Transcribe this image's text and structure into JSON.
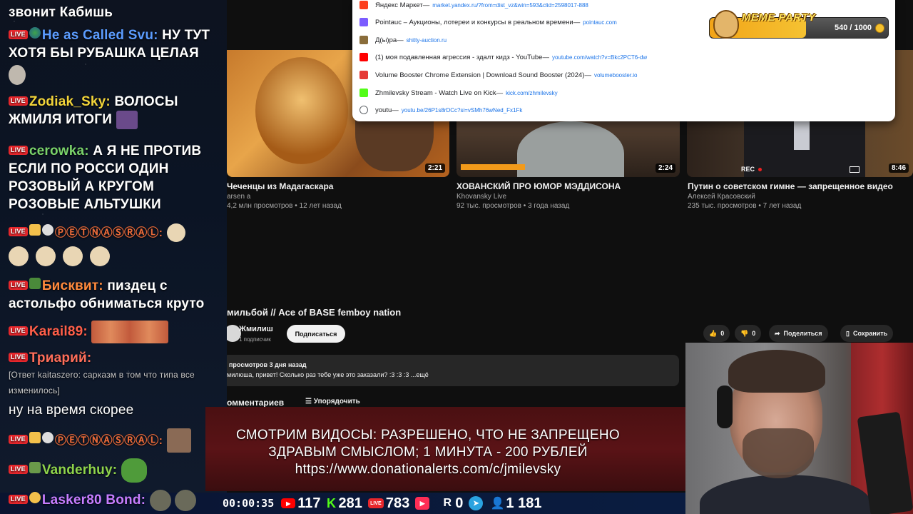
{
  "chat": {
    "messages": [
      {
        "nick": "",
        "text": "звонит Кабишь"
      },
      {
        "nick": "He as Called Svu:",
        "text": "НУ ТУТ ХОТЯ БЫ РУБАШКА ЦЕЛАЯ",
        "nick_color": "#5b9cff"
      },
      {
        "nick": "Zodiak_Sky:",
        "text": "ВОЛОСЫ ЖМИЛЯ ИТОГИ",
        "nick_color": "#f2d43a"
      },
      {
        "nick": "cerowka:",
        "text": "А Я НЕ ПРОТИВ ЕСЛИ ПО РОССИ ОДИН РОЗОВЫЙ А КРУГОМ РОЗОВЫЕ АЛЬТУШКИ",
        "nick_color": "#7ad26a"
      },
      {
        "nick": "ⓅⒺⓉⓃⒶⓈⓇⒶⓁ:",
        "text": "",
        "nick_color": "#e86a3a"
      },
      {
        "nick": "Бисквит:",
        "text": "пиздец с астольфо обниматься круто",
        "nick_color": "#ff8a3d"
      },
      {
        "nick": "Karail89:",
        "text": "",
        "nick_color": "#ff5f4a"
      },
      {
        "nick": "Триарий:",
        "text": "",
        "nick_color": "#ff6e5a"
      },
      {
        "nick": "",
        "text": "[Ответ kaitaszero: сарказм в том что типа все изменилось]"
      },
      {
        "nick": "",
        "text": "ну на время скорее"
      },
      {
        "nick": "ⓅⒺⓉⓃⒶⓈⓇⒶⓁ:",
        "text": "",
        "nick_color": "#e86a3a"
      },
      {
        "nick": "Vanderhuy:",
        "text": "",
        "nick_color": "#8fd44b"
      },
      {
        "nick": "Lasker80 Bond:",
        "text": "",
        "nick_color": "#c77dff"
      }
    ],
    "live_label": "LIVE"
  },
  "youtube": {
    "videos": [
      {
        "title": "Чеченцы из Мадагаскара",
        "channel": "arsen a",
        "meta": "4,2 млн просмотров • 12 лет назад",
        "duration": "2:21"
      },
      {
        "title": "ХОВАНСКИЙ ПРО ЮМОР МЭДДИСОНА",
        "channel": "Khovansky Live",
        "meta": "92 тыс. просмотров • 3 года назад",
        "duration": "2:24"
      },
      {
        "title": "Путин о советском гимне — запрещенное видео",
        "channel": "Алексей Красовский",
        "meta": "235 тыс. просмотров • 7 лет назад",
        "duration": "8:46",
        "rec": "REC"
      }
    ],
    "video_title": "мильбой // Ace of BASE femboy nation",
    "channel_name": "Жмилиш",
    "subscribers": "1 подписчик",
    "subscribe_label": "Подписаться",
    "likes": "0",
    "dislikes": "0",
    "share_label": "Поделиться",
    "save_label": "Сохранить",
    "desc_meta": "просмотров  3 дня назад",
    "desc_text": "милюша, привет! Сколько раз тебе уже это заказали? :3 :3 :3 ...ещё",
    "comments_label": "омментариев",
    "sort_label": "Упорядочить"
  },
  "dropdown": {
    "items": [
      {
        "title": "Яндекс Маркет",
        "url": "market.yandex.ru/?from=dist_vz&win=593&clid=2598017-888",
        "color": "#fc3f1d"
      },
      {
        "title": "Pointauc – Аукционы, лотереи и конкурсы в реальном времени",
        "url": "pointauc.com",
        "color": "#7b5cff"
      },
      {
        "title": "Д(ы)ра",
        "url": "shitty-auction.ru",
        "color": "#8a6d3b"
      },
      {
        "title": "(1) моя подавленная агрессия - здалт кидз - YouTube",
        "url": "youtube.com/watch?v=Bkc2PCT6-dw",
        "color": "#ff0000"
      },
      {
        "title": "Volume Booster Chrome Extension | Download Sound Booster (2024)",
        "url": "volumebooster.io",
        "color": "#e53935"
      },
      {
        "title": "Zhmilevsky Stream - Watch Live on Kick",
        "url": "kick.com/zhmilevsky",
        "color": "#53fc18"
      },
      {
        "title": "youtu",
        "url": "youtu.be/26P1s8rDCc?si=vSMh76wNed_Fx1Fk",
        "color": "#5f6368"
      }
    ]
  },
  "meme_party": {
    "title": "MEME PARTY",
    "count": "540 / 1000",
    "progress": 0.54
  },
  "banner": {
    "line1": "СМОТРИМ ВИДОСЫ: РАЗРЕШЕНО, ЧТО НЕ ЗАПРЕЩЕНО",
    "line2": "ЗДРАВЫМ СМЫСЛОМ; 1 МИНУТА - 200 РУБЛЕЙ",
    "line3": "https://www.donationalerts.com/c/jmilevsky"
  },
  "stats": {
    "time": "00:00:35",
    "youtube": "117",
    "kick": "281",
    "vk": "783",
    "rutube": "0",
    "telegram": "",
    "total": "1 181"
  }
}
